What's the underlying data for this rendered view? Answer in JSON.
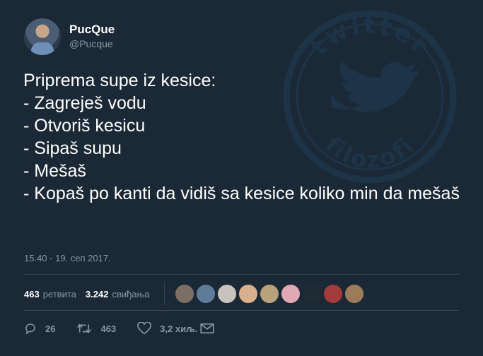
{
  "author": {
    "display_name": "PucQue",
    "handle": "@Pucque"
  },
  "tweet": {
    "text": "Priprema supe iz kesice:\n- Zagreješ vodu\n- Otvoriš kesicu\n- Sipaš supu\n- Mešaš\n- Kopaš po kanti da vidiš sa kesice koliko min da mešaš",
    "timestamp": "15.40 - 19. сеп 2017."
  },
  "stats": {
    "retweets_count": "463",
    "retweets_label": "ретвита",
    "likes_count": "3.242",
    "likes_label": "свиђања"
  },
  "likers": [
    "#7b6f66",
    "#5f7d9a",
    "#c8c3bd",
    "#d9b08c",
    "#b8a27a",
    "#e0a9b5",
    "#1f2b35",
    "#a23b3b",
    "#9d7b5a"
  ],
  "actions": {
    "replies": "26",
    "retweets": "463",
    "likes": "3,2 хиљ."
  },
  "colors": {
    "background": "#1b2836",
    "muted": "#8899a6",
    "watermark": "#1f3e58"
  }
}
